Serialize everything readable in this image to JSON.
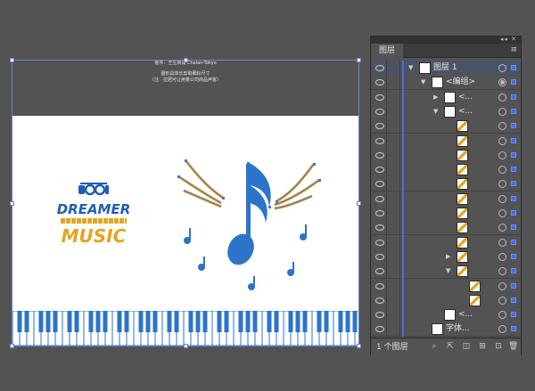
{
  "canvas": {
    "note_line1": "客件：王生商润  Chalan-Tokyo",
    "note_line2": "图形具体长剪取细标尺寸",
    "note_line3": "（注：拉居可让用着公司商品声客）"
  },
  "logo": {
    "word1": "DREAMER",
    "word2": "MUSIC"
  },
  "colors": {
    "accent_blue": "#1e5fb3",
    "accent_gold": "#e3a51e",
    "selection_blue": "#4a6be0"
  },
  "panel": {
    "tab_title": "图层",
    "titlebar_icons": "◂◂ ✕",
    "menu_icon": "hamburger-menu-icon",
    "rows": [
      {
        "label": "图层 1",
        "twirl": "▼",
        "indent": 0,
        "selected": true,
        "target_on": false
      },
      {
        "label": "<编组>",
        "twirl": "▼",
        "indent": 1,
        "selected": false,
        "target_on": true
      },
      {
        "label": "<...",
        "twirl": "▶",
        "indent": 2,
        "selected": false,
        "target_on": false
      },
      {
        "label": "<...",
        "twirl": "▼",
        "indent": 2,
        "selected": false,
        "target_on": false
      },
      {
        "label": "",
        "twirl": "",
        "indent": 3,
        "selected": false,
        "target_on": false
      },
      {
        "label": "",
        "twirl": "",
        "indent": 3,
        "selected": false,
        "target_on": false
      },
      {
        "label": "",
        "twirl": "",
        "indent": 3,
        "selected": false,
        "target_on": false
      },
      {
        "label": "",
        "twirl": "",
        "indent": 3,
        "selected": false,
        "target_on": false
      },
      {
        "label": "",
        "twirl": "",
        "indent": 3,
        "selected": false,
        "target_on": false
      },
      {
        "label": "",
        "twirl": "",
        "indent": 3,
        "selected": false,
        "target_on": false
      },
      {
        "label": "",
        "twirl": "",
        "indent": 3,
        "selected": false,
        "target_on": false
      },
      {
        "label": "",
        "twirl": "",
        "indent": 3,
        "selected": false,
        "target_on": false
      },
      {
        "label": "",
        "twirl": "",
        "indent": 3,
        "selected": false,
        "target_on": false
      },
      {
        "label": "",
        "twirl": "▶",
        "indent": 3,
        "selected": false,
        "target_on": false
      },
      {
        "label": "",
        "twirl": "▼",
        "indent": 3,
        "selected": false,
        "target_on": false
      },
      {
        "label": "",
        "twirl": "",
        "indent": 4,
        "selected": false,
        "target_on": false
      },
      {
        "label": "",
        "twirl": "",
        "indent": 4,
        "selected": false,
        "target_on": false
      },
      {
        "label": "<...",
        "twirl": "",
        "indent": 2,
        "selected": false,
        "target_on": false
      },
      {
        "label": "字体...",
        "twirl": "",
        "indent": 1,
        "selected": false,
        "target_on": false
      }
    ],
    "footer_count": "1 个图层",
    "footer_icons": [
      "search-icon",
      "export-icon",
      "clipping-mask-icon",
      "new-sublayer-icon",
      "new-layer-icon",
      "delete-icon"
    ]
  }
}
